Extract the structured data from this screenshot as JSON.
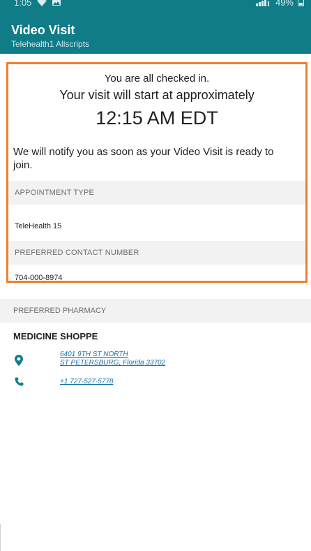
{
  "status_bar": {
    "time": "1:05",
    "battery": "49%"
  },
  "header": {
    "title": "Video Visit",
    "subtitle": "Telehealth1 Allscripts"
  },
  "checkin": {
    "line1": "You are all checked in.",
    "line2": "Your visit will start at approximately",
    "time": "12:15 AM EDT",
    "notify": "We will notify you as soon as your Video Visit is ready to join."
  },
  "appointment": {
    "type_label": "APPOINTMENT TYPE",
    "type_value": "TeleHealth 15",
    "contact_label": "PREFERRED CONTACT NUMBER",
    "contact_value": "704-000-8974"
  },
  "pharmacy": {
    "label": "PREFERRED PHARMACY",
    "name": "MEDICINE SHOPPE",
    "address_line1": "6401 9TH ST NORTH",
    "address_line2": "ST PETERSBURG, Florida 33702",
    "phone": "+1 727-527-5778"
  },
  "colors": {
    "appbar": "#0f7c88",
    "highlight_border": "#ef7f2c",
    "link": "#1a6fa6",
    "section_bg": "#f2f2f2"
  },
  "icons": [
    "wifi-icon",
    "image-icon",
    "signal-icon",
    "battery-icon",
    "location-pin-icon",
    "phone-icon"
  ]
}
